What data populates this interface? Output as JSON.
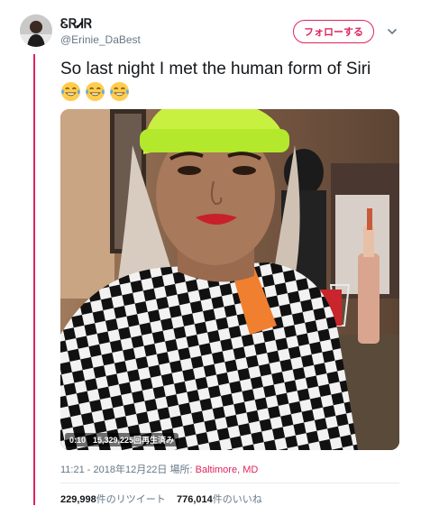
{
  "author": {
    "display_name": "ᏋᏒᏗᏒ",
    "handle": "@Erinie_DaBest"
  },
  "follow_label": "フォローする",
  "tweet": {
    "text": "So last night I met the human form of Siri",
    "emojis": [
      "face-with-tears-of-joy",
      "face-with-tears-of-joy",
      "face-with-tears-of-joy"
    ]
  },
  "video": {
    "duration": "0:10",
    "views": "15,329,225回再生済み"
  },
  "meta": {
    "time": "11:21 - 2018年12月22日",
    "location_label": "場所:",
    "location": "Baltimore, MD"
  },
  "stats": {
    "retweets_count": "229,998",
    "retweets_label": "件のリツイート",
    "likes_count": "776,014",
    "likes_label": "件のいいね"
  },
  "colors": {
    "accent": "#e0245e",
    "secondary_text": "#657786",
    "primary_text": "#14171a"
  }
}
